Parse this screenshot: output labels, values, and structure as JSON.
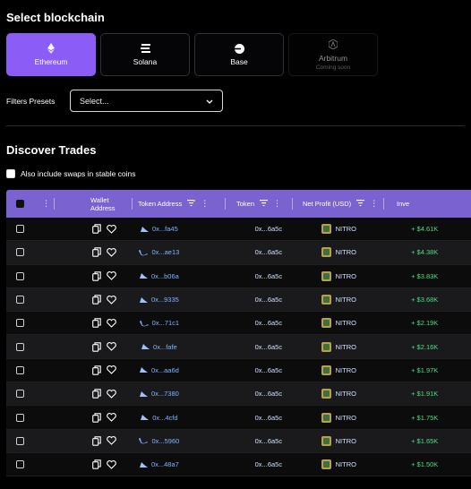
{
  "select_chain": {
    "title": "Select blockchain",
    "chains": [
      {
        "label": "Ethereum",
        "icon": "ethereum-icon",
        "active": true
      },
      {
        "label": "Solana",
        "icon": "solana-icon"
      },
      {
        "label": "Base",
        "icon": "base-icon"
      },
      {
        "label": "Arbitrum",
        "sub": "Coming soon",
        "icon": "arbitrum-icon",
        "disabled": true
      }
    ]
  },
  "filters": {
    "label": "Filters Presets",
    "placeholder": "Select..."
  },
  "discover": {
    "title": "Discover Trades",
    "stable_label": "Also include swaps in stable coins"
  },
  "table": {
    "headers": {
      "wallet": "Wallet Address",
      "token_address": "Token Address",
      "token": "Token",
      "profit": "Net Profit (USD)",
      "next": "Inve"
    },
    "rows": [
      {
        "wallet": "0x...fa45",
        "wallet_icon": "shark",
        "token_address": "0x...6a5c",
        "token": "NITRO",
        "profit": "+ $4.61K"
      },
      {
        "wallet": "0x...ae13",
        "wallet_icon": "whale",
        "token_address": "0x...6a5c",
        "token": "NITRO",
        "profit": "+ $4.38K"
      },
      {
        "wallet": "0x...b06a",
        "wallet_icon": "shark",
        "token_address": "0x...6a5c",
        "token": "NITRO",
        "profit": "+ $3.83K"
      },
      {
        "wallet": "0x...9335",
        "wallet_icon": "shark",
        "token_address": "0x...6a5c",
        "token": "NITRO",
        "profit": "+ $3.68K"
      },
      {
        "wallet": "0x...71c1",
        "wallet_icon": "whale",
        "token_address": "0x...6a5c",
        "token": "NITRO",
        "profit": "+ $2.19K"
      },
      {
        "wallet": "0x...fafe",
        "wallet_icon": "shark",
        "token_address": "0x...6a5c",
        "token": "NITRO",
        "profit": "+ $2.16K"
      },
      {
        "wallet": "0x...aa6d",
        "wallet_icon": "shark",
        "token_address": "0x...6a5c",
        "token": "NITRO",
        "profit": "+ $1.97K"
      },
      {
        "wallet": "0x...7380",
        "wallet_icon": "shark",
        "token_address": "0x...6a5c",
        "token": "NITRO",
        "profit": "+ $1.91K"
      },
      {
        "wallet": "0x...4cfd",
        "wallet_icon": "shark",
        "token_address": "0x...6a5c",
        "token": "NITRO",
        "profit": "+ $1.75K"
      },
      {
        "wallet": "0x...5960",
        "wallet_icon": "whale",
        "token_address": "0x...6a5c",
        "token": "NITRO",
        "profit": "+ $1.65K"
      },
      {
        "wallet": "0x...48a7",
        "wallet_icon": "shark",
        "token_address": "0x...6a5c",
        "token": "NITRO",
        "profit": "+ $1.50K"
      }
    ]
  },
  "colors": {
    "accent": "#8b5cf6",
    "header": "#7a62d0",
    "profit": "#4ade80",
    "address": "#7fb3ff"
  }
}
